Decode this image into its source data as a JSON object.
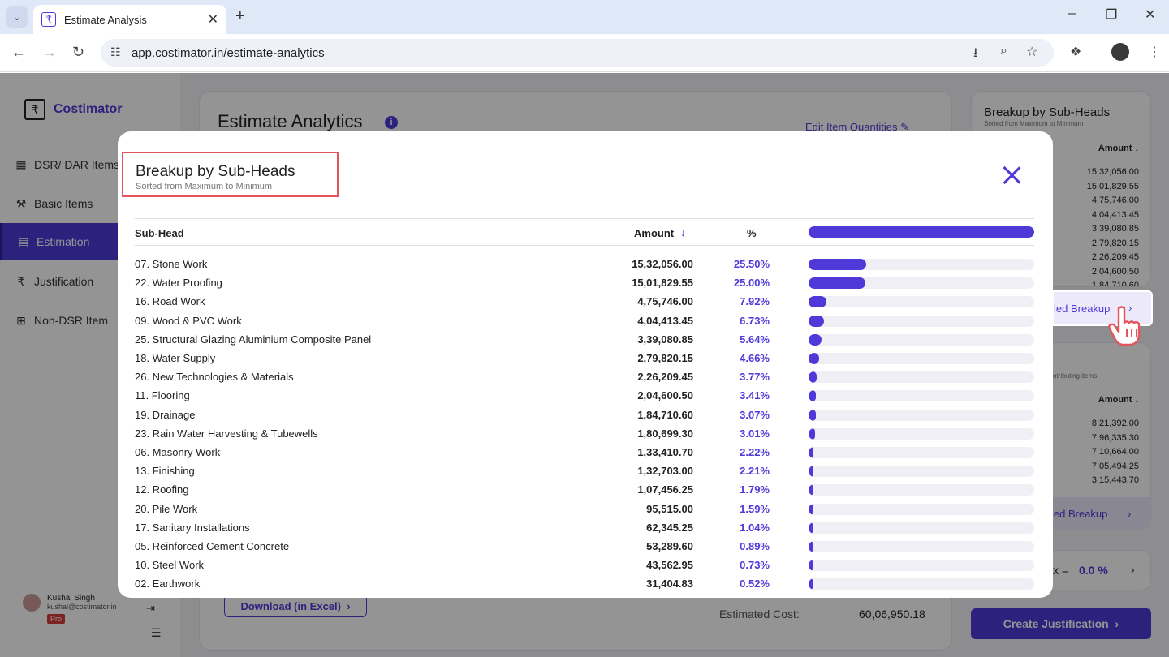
{
  "browser": {
    "tab_title": "Estimate Analysis",
    "url": "app.costimator.in/estimate-analytics"
  },
  "sidebar": {
    "logo": "Costimator",
    "items": [
      {
        "label": "DSR/ DAR Items",
        "icon": "table-icon"
      },
      {
        "label": "Basic Items",
        "icon": "tools-icon"
      },
      {
        "label": "Estimation",
        "icon": "grid-icon"
      },
      {
        "label": "Justification",
        "icon": "rupee-icon"
      },
      {
        "label": "Non-DSR Item",
        "icon": "add-box-icon"
      }
    ],
    "active_index": 2,
    "user": {
      "name": "Kushal Singh",
      "email": "kushal@costimator.in",
      "badge": "Pro"
    }
  },
  "main": {
    "title": "Estimate Analytics",
    "info_icon": "i",
    "edit_link": "Edit Item Quantities",
    "download_button": "Download (in Excel)",
    "estimated_cost_label": "Estimated Cost:",
    "estimated_cost_value": "60,06,950.18"
  },
  "right_panel": {
    "title": "Breakup by Sub-Heads",
    "subtitle": "Sorted from Maximum to Minimum",
    "amount_header": "Amount",
    "amounts": [
      "15,32,056.00",
      "15,01,829.55",
      "4,75,746.00",
      "4,04,413.45",
      "3,39,080.85",
      "2,79,820.15",
      "2,26,209.45",
      "2,04,600.50",
      "1,84,710.60"
    ],
    "detailed_breakup_label": "led Breakup",
    "items_subtitle": "ntributing items",
    "items_amount_header": "Amount",
    "items_amounts": [
      "8,21,392.00",
      "7,96,335.30",
      "7,10,664.00",
      "7,05,494.25",
      "3,15,443.70"
    ],
    "items_breakup_label": "led Breakup",
    "ratio_label": "x =",
    "ratio_value": "0.0 %",
    "create_button": "Create Justification"
  },
  "modal": {
    "title": "Breakup by Sub-Heads",
    "subtitle": "Sorted from Maximum to Minimum",
    "columns": {
      "subhead": "Sub-Head",
      "amount": "Amount",
      "percent": "%"
    },
    "rows": [
      {
        "name": "07. Stone Work",
        "amount": "15,32,056.00",
        "pct": "25.50%",
        "share": 25.5
      },
      {
        "name": "22. Water Proofing",
        "amount": "15,01,829.55",
        "pct": "25.00%",
        "share": 25.0
      },
      {
        "name": "16. Road Work",
        "amount": "4,75,746.00",
        "pct": "7.92%",
        "share": 7.92
      },
      {
        "name": "09. Wood & PVC Work",
        "amount": "4,04,413.45",
        "pct": "6.73%",
        "share": 6.73
      },
      {
        "name": "25. Structural Glazing Aluminium Composite Panel",
        "amount": "3,39,080.85",
        "pct": "5.64%",
        "share": 5.64
      },
      {
        "name": "18. Water Supply",
        "amount": "2,79,820.15",
        "pct": "4.66%",
        "share": 4.66
      },
      {
        "name": "26. New Technologies & Materials",
        "amount": "2,26,209.45",
        "pct": "3.77%",
        "share": 3.77
      },
      {
        "name": "11. Flooring",
        "amount": "2,04,600.50",
        "pct": "3.41%",
        "share": 3.41
      },
      {
        "name": "19. Drainage",
        "amount": "1,84,710.60",
        "pct": "3.07%",
        "share": 3.07
      },
      {
        "name": "23. Rain Water Harvesting & Tubewells",
        "amount": "1,80,699.30",
        "pct": "3.01%",
        "share": 3.01
      },
      {
        "name": "06. Masonry Work",
        "amount": "1,33,410.70",
        "pct": "2.22%",
        "share": 2.22
      },
      {
        "name": "13. Finishing",
        "amount": "1,32,703.00",
        "pct": "2.21%",
        "share": 2.21
      },
      {
        "name": "12. Roofing",
        "amount": "1,07,456.25",
        "pct": "1.79%",
        "share": 1.79
      },
      {
        "name": "20. Pile Work",
        "amount": "95,515.00",
        "pct": "1.59%",
        "share": 1.59
      },
      {
        "name": "17. Sanitary Installations",
        "amount": "62,345.25",
        "pct": "1.04%",
        "share": 1.04
      },
      {
        "name": "05. Reinforced Cement Concrete",
        "amount": "53,289.60",
        "pct": "0.89%",
        "share": 0.89
      },
      {
        "name": "10. Steel Work",
        "amount": "43,562.95",
        "pct": "0.73%",
        "share": 0.73
      },
      {
        "name": "02. Earthwork",
        "amount": "31,404.83",
        "pct": "0.52%",
        "share": 0.52
      }
    ]
  },
  "colors": {
    "accent": "#4f3ad9",
    "highlight_border": "#e4545c",
    "bar_track": "#efeff5"
  }
}
